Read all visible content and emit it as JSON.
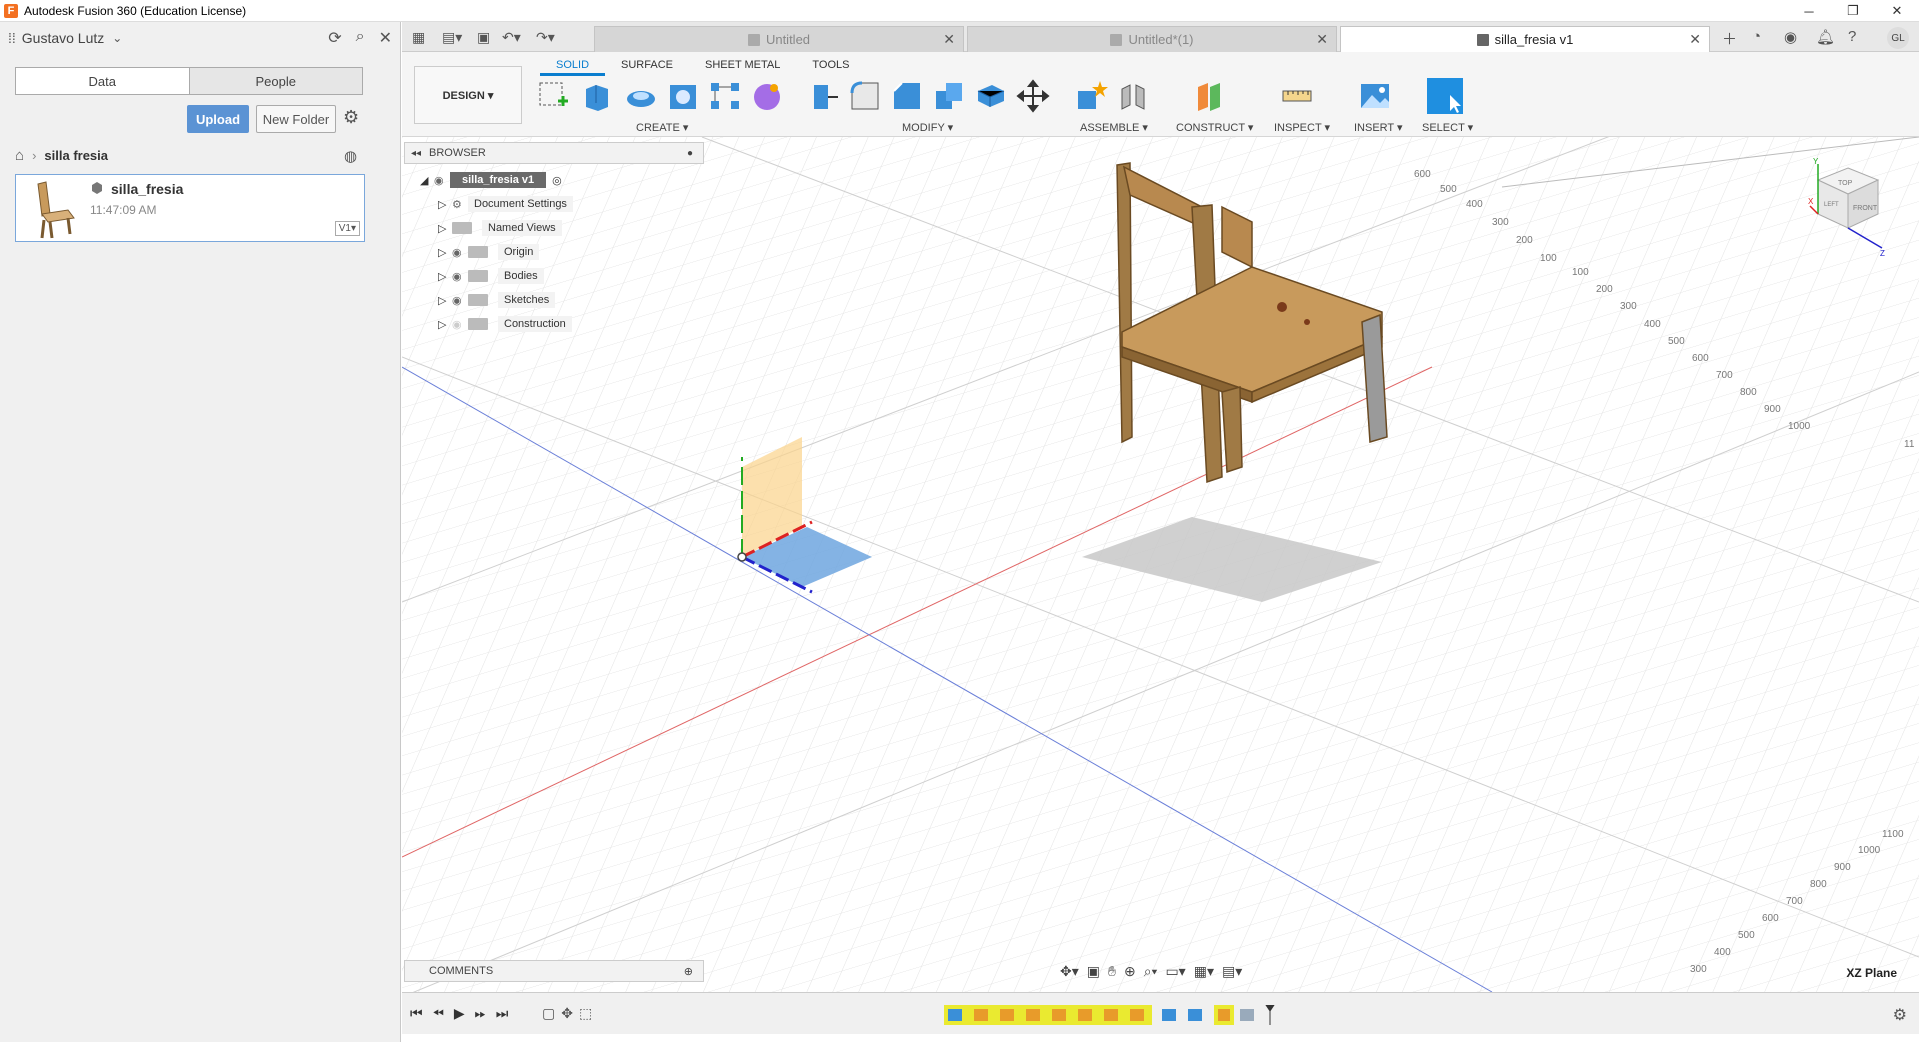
{
  "window": {
    "title": "Autodesk Fusion 360 (Education License)",
    "logo_letter": "F"
  },
  "data_panel": {
    "user": "Gustavo Lutz",
    "tabs": [
      "Data",
      "People"
    ],
    "upload_label": "Upload",
    "new_folder_label": "New Folder",
    "breadcrumb": "silla fresia",
    "file": {
      "name": "silla_fresia",
      "time": "11:47:09 AM",
      "version": "V1▾"
    }
  },
  "doc_tabs": [
    {
      "label": "Untitled",
      "active": false
    },
    {
      "label": "Untitled*(1)",
      "active": false
    },
    {
      "label": "silla_fresia v1",
      "active": true
    }
  ],
  "toolbar": {
    "workspace": "DESIGN ▾",
    "tabs": [
      "SOLID",
      "SURFACE",
      "SHEET METAL",
      "TOOLS"
    ],
    "groups": [
      "CREATE ▾",
      "MODIFY ▾",
      "ASSEMBLE ▾",
      "CONSTRUCT ▾",
      "INSPECT ▾",
      "INSERT ▾",
      "SELECT ▾"
    ]
  },
  "browser": {
    "title": "BROWSER",
    "root": "silla_fresia v1",
    "nodes": [
      "Document Settings",
      "Named Views",
      "Origin",
      "Bodies",
      "Sketches",
      "Construction"
    ]
  },
  "comments": {
    "title": "COMMENTS"
  },
  "viewport": {
    "plane_label": "XZ Plane",
    "ruler_right": [
      "600",
      "500",
      "400",
      "300",
      "200",
      "100",
      "100",
      "200",
      "300",
      "400",
      "500",
      "600",
      "700",
      "800",
      "900",
      "1000",
      "11"
    ],
    "ruler_bottom": [
      "1100",
      "1000",
      "900",
      "800",
      "700",
      "600",
      "500",
      "400",
      "300"
    ],
    "viewcube": {
      "top": "TOP",
      "front": "FRONT",
      "left": "LEFT",
      "x": "X",
      "y": "Y",
      "z": "Z"
    }
  },
  "avatar": "GL",
  "colors": {
    "accent": "#0a7ecf",
    "timeline_step": "#e8e826",
    "upload": "#5b93d4",
    "wood": "#c89a5c"
  }
}
